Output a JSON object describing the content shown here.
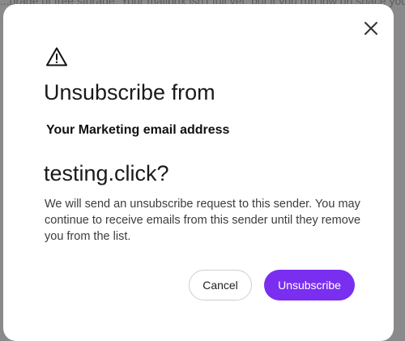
{
  "backdrop": {
    "text": "...orage of free storage. Your mailbox isn't full yet, but if you run low on space you..."
  },
  "dialog": {
    "title_prefix": "Unsubscribe from",
    "sender_label": "Your Marketing email address",
    "sender_domain": "testing.click?",
    "body": "We will send an unsubscribe request to this sender. You may continue to receive emails from this sender until they remove you from the list.",
    "cancel_label": "Cancel",
    "unsubscribe_label": "Unsubscribe",
    "icons": {
      "close": "close-icon",
      "warning": "warning-triangle-icon"
    }
  },
  "colors": {
    "primary": "#7a2ff0",
    "overlay": "#8a8a8a",
    "dialog_bg": "#ffffff"
  }
}
